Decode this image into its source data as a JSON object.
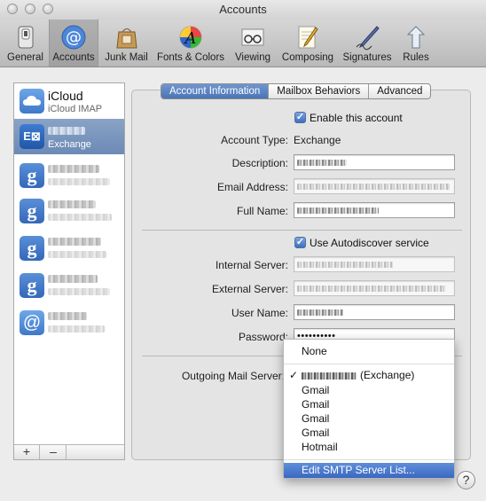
{
  "window": {
    "title": "Accounts"
  },
  "toolbar": {
    "items": [
      {
        "label": "General",
        "icon": "general-switch-icon"
      },
      {
        "label": "Accounts",
        "icon": "at-sign-icon"
      },
      {
        "label": "Junk Mail",
        "icon": "junk-bag-icon"
      },
      {
        "label": "Fonts & Colors",
        "icon": "color-font-icon"
      },
      {
        "label": "Viewing",
        "icon": "glasses-icon"
      },
      {
        "label": "Composing",
        "icon": "pencil-paper-icon"
      },
      {
        "label": "Signatures",
        "icon": "pen-signature-icon"
      },
      {
        "label": "Rules",
        "icon": "rules-arrow-icon"
      }
    ],
    "selected": "Accounts"
  },
  "sidebar": {
    "accounts": [
      {
        "name": "iCloud",
        "subtitle": "iCloud IMAP",
        "icon": "icloud-icon"
      },
      {
        "name": "",
        "subtitle": "Exchange",
        "icon": "exchange-icon"
      },
      {
        "name": "",
        "subtitle": "",
        "icon": "google-icon"
      },
      {
        "name": "",
        "subtitle": "",
        "icon": "google-icon"
      },
      {
        "name": "",
        "subtitle": "",
        "icon": "google-icon"
      },
      {
        "name": "",
        "subtitle": "",
        "icon": "google-icon"
      },
      {
        "name": "",
        "subtitle": "",
        "icon": "at-sign-icon"
      }
    ],
    "add_label": "+",
    "remove_label": "–"
  },
  "tabs": {
    "items": [
      "Account Information",
      "Mailbox Behaviors",
      "Advanced"
    ],
    "active": "Account Information"
  },
  "form": {
    "enable_account_label": "Enable this account",
    "account_type_label": "Account Type:",
    "account_type_value": "Exchange",
    "description_label": "Description:",
    "email_label": "Email Address:",
    "fullname_label": "Full Name:",
    "autodiscover_label": "Use Autodiscover service",
    "internal_server_label": "Internal Server:",
    "external_server_label": "External Server:",
    "username_label": "User Name:",
    "password_label": "Password:",
    "password_value": "••••••••••",
    "outgoing_label": "Outgoing Mail Server:"
  },
  "smtp_menu": {
    "items": [
      "None",
      "(Exchange)",
      "Gmail",
      "Gmail",
      "Gmail",
      "Gmail",
      "Hotmail",
      "Edit SMTP Server List..."
    ],
    "checked_item": "(Exchange)",
    "highlighted_item": "Edit SMTP Server List..."
  },
  "help": {
    "label": "?"
  },
  "colors": {
    "accent": "#4a74b5",
    "selection": "#6c8ab6"
  }
}
